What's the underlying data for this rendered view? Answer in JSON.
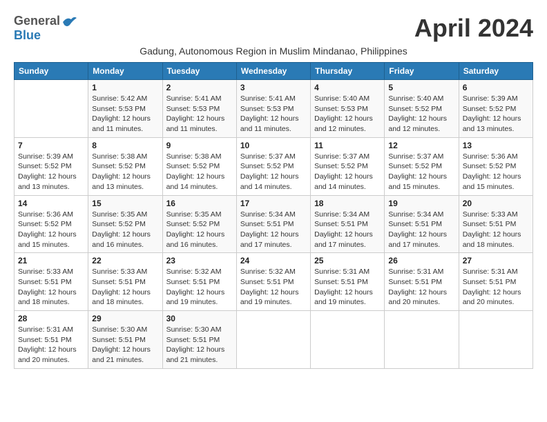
{
  "header": {
    "logo_general": "General",
    "logo_blue": "Blue",
    "month_title": "April 2024",
    "subtitle": "Gadung, Autonomous Region in Muslim Mindanao, Philippines"
  },
  "calendar": {
    "weekdays": [
      "Sunday",
      "Monday",
      "Tuesday",
      "Wednesday",
      "Thursday",
      "Friday",
      "Saturday"
    ],
    "weeks": [
      [
        {
          "day": "",
          "info": ""
        },
        {
          "day": "1",
          "info": "Sunrise: 5:42 AM\nSunset: 5:53 PM\nDaylight: 12 hours\nand 11 minutes."
        },
        {
          "day": "2",
          "info": "Sunrise: 5:41 AM\nSunset: 5:53 PM\nDaylight: 12 hours\nand 11 minutes."
        },
        {
          "day": "3",
          "info": "Sunrise: 5:41 AM\nSunset: 5:53 PM\nDaylight: 12 hours\nand 11 minutes."
        },
        {
          "day": "4",
          "info": "Sunrise: 5:40 AM\nSunset: 5:53 PM\nDaylight: 12 hours\nand 12 minutes."
        },
        {
          "day": "5",
          "info": "Sunrise: 5:40 AM\nSunset: 5:52 PM\nDaylight: 12 hours\nand 12 minutes."
        },
        {
          "day": "6",
          "info": "Sunrise: 5:39 AM\nSunset: 5:52 PM\nDaylight: 12 hours\nand 13 minutes."
        }
      ],
      [
        {
          "day": "7",
          "info": "Sunrise: 5:39 AM\nSunset: 5:52 PM\nDaylight: 12 hours\nand 13 minutes."
        },
        {
          "day": "8",
          "info": "Sunrise: 5:38 AM\nSunset: 5:52 PM\nDaylight: 12 hours\nand 13 minutes."
        },
        {
          "day": "9",
          "info": "Sunrise: 5:38 AM\nSunset: 5:52 PM\nDaylight: 12 hours\nand 14 minutes."
        },
        {
          "day": "10",
          "info": "Sunrise: 5:37 AM\nSunset: 5:52 PM\nDaylight: 12 hours\nand 14 minutes."
        },
        {
          "day": "11",
          "info": "Sunrise: 5:37 AM\nSunset: 5:52 PM\nDaylight: 12 hours\nand 14 minutes."
        },
        {
          "day": "12",
          "info": "Sunrise: 5:37 AM\nSunset: 5:52 PM\nDaylight: 12 hours\nand 15 minutes."
        },
        {
          "day": "13",
          "info": "Sunrise: 5:36 AM\nSunset: 5:52 PM\nDaylight: 12 hours\nand 15 minutes."
        }
      ],
      [
        {
          "day": "14",
          "info": "Sunrise: 5:36 AM\nSunset: 5:52 PM\nDaylight: 12 hours\nand 15 minutes."
        },
        {
          "day": "15",
          "info": "Sunrise: 5:35 AM\nSunset: 5:52 PM\nDaylight: 12 hours\nand 16 minutes."
        },
        {
          "day": "16",
          "info": "Sunrise: 5:35 AM\nSunset: 5:52 PM\nDaylight: 12 hours\nand 16 minutes."
        },
        {
          "day": "17",
          "info": "Sunrise: 5:34 AM\nSunset: 5:51 PM\nDaylight: 12 hours\nand 17 minutes."
        },
        {
          "day": "18",
          "info": "Sunrise: 5:34 AM\nSunset: 5:51 PM\nDaylight: 12 hours\nand 17 minutes."
        },
        {
          "day": "19",
          "info": "Sunrise: 5:34 AM\nSunset: 5:51 PM\nDaylight: 12 hours\nand 17 minutes."
        },
        {
          "day": "20",
          "info": "Sunrise: 5:33 AM\nSunset: 5:51 PM\nDaylight: 12 hours\nand 18 minutes."
        }
      ],
      [
        {
          "day": "21",
          "info": "Sunrise: 5:33 AM\nSunset: 5:51 PM\nDaylight: 12 hours\nand 18 minutes."
        },
        {
          "day": "22",
          "info": "Sunrise: 5:33 AM\nSunset: 5:51 PM\nDaylight: 12 hours\nand 18 minutes."
        },
        {
          "day": "23",
          "info": "Sunrise: 5:32 AM\nSunset: 5:51 PM\nDaylight: 12 hours\nand 19 minutes."
        },
        {
          "day": "24",
          "info": "Sunrise: 5:32 AM\nSunset: 5:51 PM\nDaylight: 12 hours\nand 19 minutes."
        },
        {
          "day": "25",
          "info": "Sunrise: 5:31 AM\nSunset: 5:51 PM\nDaylight: 12 hours\nand 19 minutes."
        },
        {
          "day": "26",
          "info": "Sunrise: 5:31 AM\nSunset: 5:51 PM\nDaylight: 12 hours\nand 20 minutes."
        },
        {
          "day": "27",
          "info": "Sunrise: 5:31 AM\nSunset: 5:51 PM\nDaylight: 12 hours\nand 20 minutes."
        }
      ],
      [
        {
          "day": "28",
          "info": "Sunrise: 5:31 AM\nSunset: 5:51 PM\nDaylight: 12 hours\nand 20 minutes."
        },
        {
          "day": "29",
          "info": "Sunrise: 5:30 AM\nSunset: 5:51 PM\nDaylight: 12 hours\nand 21 minutes."
        },
        {
          "day": "30",
          "info": "Sunrise: 5:30 AM\nSunset: 5:51 PM\nDaylight: 12 hours\nand 21 minutes."
        },
        {
          "day": "",
          "info": ""
        },
        {
          "day": "",
          "info": ""
        },
        {
          "day": "",
          "info": ""
        },
        {
          "day": "",
          "info": ""
        }
      ]
    ]
  }
}
